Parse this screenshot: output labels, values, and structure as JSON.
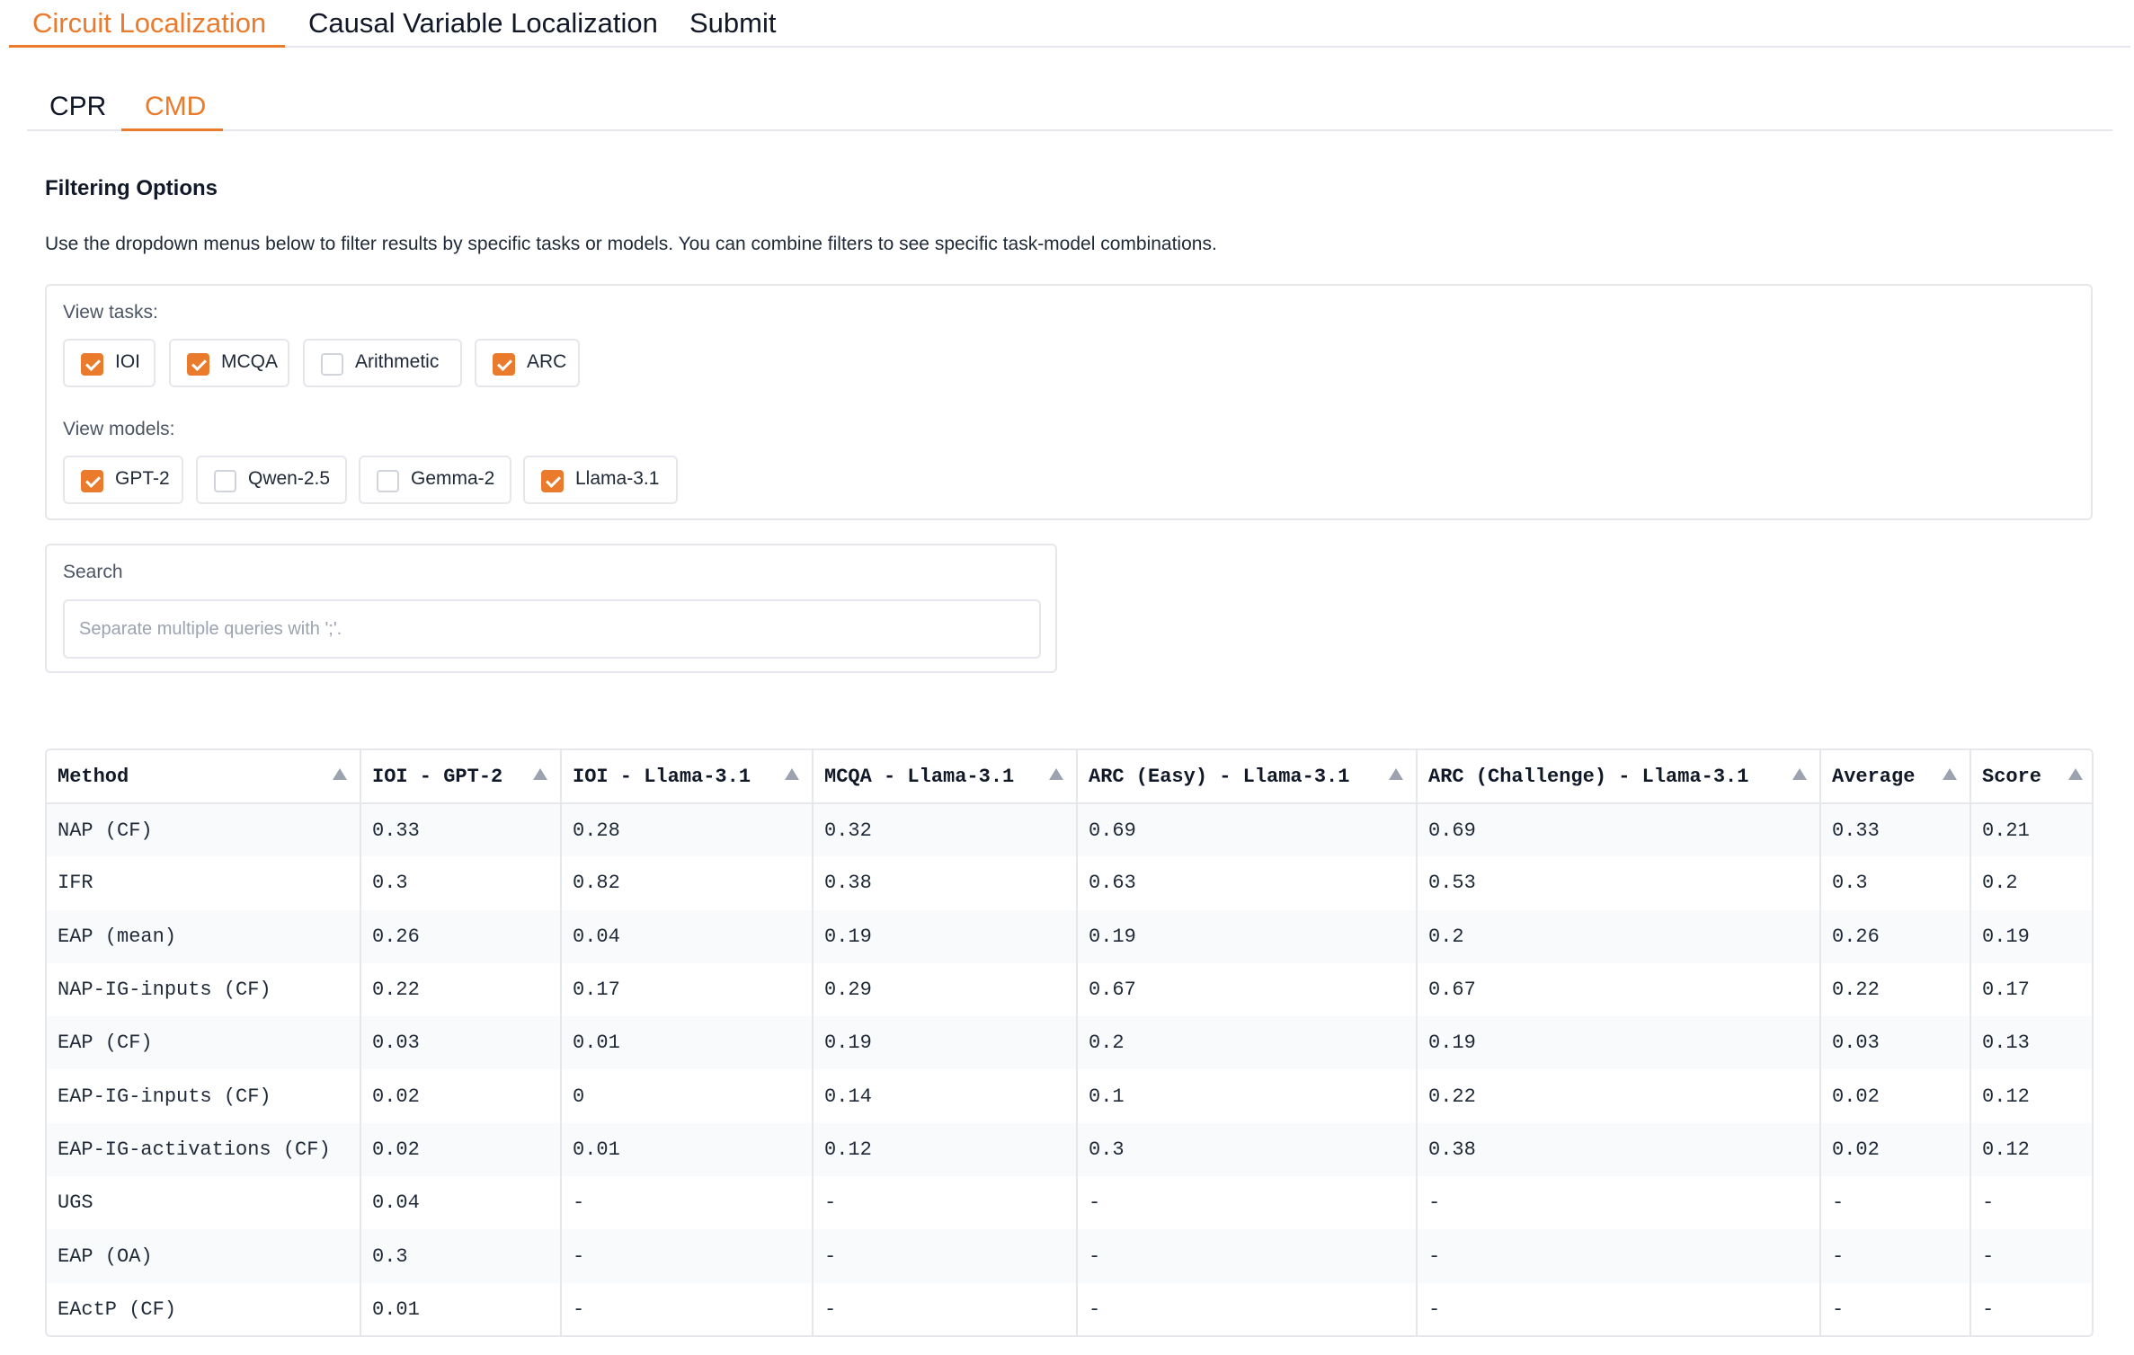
{
  "top_tabs": [
    {
      "label": "Circuit Localization",
      "active": true
    },
    {
      "label": "Causal Variable Localization",
      "active": false
    },
    {
      "label": "Submit",
      "active": false
    }
  ],
  "sub_tabs": [
    {
      "label": "CPR",
      "active": false
    },
    {
      "label": "CMD",
      "active": true
    }
  ],
  "filtering": {
    "title": "Filtering Options",
    "description": "Use the dropdown menus below to filter results by specific tasks or models. You can combine filters to see specific task-model combinations.",
    "tasks_label": "View tasks:",
    "tasks": [
      {
        "label": "IOI",
        "checked": true
      },
      {
        "label": "MCQA",
        "checked": true
      },
      {
        "label": "Arithmetic",
        "checked": false
      },
      {
        "label": "ARC",
        "checked": true
      }
    ],
    "models_label": "View models:",
    "models": [
      {
        "label": "GPT-2",
        "checked": true
      },
      {
        "label": "Qwen-2.5",
        "checked": false
      },
      {
        "label": "Gemma-2",
        "checked": false
      },
      {
        "label": "Llama-3.1",
        "checked": true
      }
    ]
  },
  "search": {
    "label": "Search",
    "placeholder": "Separate multiple queries with ';'.",
    "value": ""
  },
  "table": {
    "columns": [
      "Method",
      "IOI - GPT-2",
      "IOI - Llama-3.1",
      "MCQA - Llama-3.1",
      "ARC (Easy) - Llama-3.1",
      "ARC (Challenge) - Llama-3.1",
      "Average",
      "Score"
    ],
    "rows": [
      [
        "NAP (CF)",
        "0.33",
        "0.28",
        "0.32",
        "0.69",
        "0.69",
        "0.33",
        "0.21"
      ],
      [
        "IFR",
        "0.3",
        "0.82",
        "0.38",
        "0.63",
        "0.53",
        "0.3",
        "0.2"
      ],
      [
        "EAP (mean)",
        "0.26",
        "0.04",
        "0.19",
        "0.19",
        "0.2",
        "0.26",
        "0.19"
      ],
      [
        "NAP-IG-inputs (CF)",
        "0.22",
        "0.17",
        "0.29",
        "0.67",
        "0.67",
        "0.22",
        "0.17"
      ],
      [
        "EAP (CF)",
        "0.03",
        "0.01",
        "0.19",
        "0.2",
        "0.19",
        "0.03",
        "0.13"
      ],
      [
        "EAP-IG-inputs (CF)",
        "0.02",
        "0",
        "0.14",
        "0.1",
        "0.22",
        "0.02",
        "0.12"
      ],
      [
        "EAP-IG-activations (CF)",
        "0.02",
        "0.01",
        "0.12",
        "0.3",
        "0.38",
        "0.02",
        "0.12"
      ],
      [
        "UGS",
        "0.04",
        "-",
        "-",
        "-",
        "-",
        "-",
        "-"
      ],
      [
        "EAP (OA)",
        "0.3",
        "-",
        "-",
        "-",
        "-",
        "-",
        "-"
      ],
      [
        "EActP (CF)",
        "0.01",
        "-",
        "-",
        "-",
        "-",
        "-",
        "-"
      ]
    ]
  },
  "colors": {
    "accent": "#ea7a2c",
    "border": "#e5e7eb",
    "row_alt": "#f9fafb"
  }
}
